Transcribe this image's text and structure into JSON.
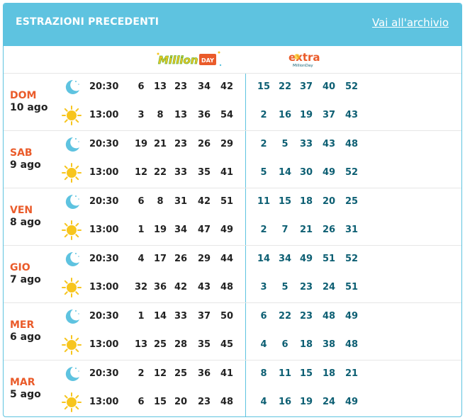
{
  "header": {
    "title": "ESTRAZIONI PRECEDENTI",
    "archive_link": "Vai all'archivio"
  },
  "logos": {
    "million": "Million",
    "million_day": "DAY",
    "extra": "extra",
    "extra_sub": "MillionDay"
  },
  "colors": {
    "header_bg": "#5ec3e0",
    "day_name": "#ea5b2a",
    "extra_numbers": "#0d5f73",
    "moon": "#5ec3e0",
    "sun": "#f7c51e"
  },
  "icons": {
    "evening": "moon-icon",
    "midday": "sun-icon"
  },
  "days": [
    {
      "name": "DOM",
      "date": "10 ago",
      "draws": [
        {
          "time": "20:30",
          "numbers": [
            "6",
            "13",
            "23",
            "34",
            "42"
          ],
          "extra": [
            "15",
            "22",
            "37",
            "40",
            "52"
          ]
        },
        {
          "time": "13:00",
          "numbers": [
            "3",
            "8",
            "13",
            "36",
            "54"
          ],
          "extra": [
            "2",
            "16",
            "19",
            "37",
            "43"
          ]
        }
      ]
    },
    {
      "name": "SAB",
      "date": "9 ago",
      "draws": [
        {
          "time": "20:30",
          "numbers": [
            "19",
            "21",
            "23",
            "26",
            "29"
          ],
          "extra": [
            "2",
            "5",
            "33",
            "43",
            "48"
          ]
        },
        {
          "time": "13:00",
          "numbers": [
            "12",
            "22",
            "33",
            "35",
            "41"
          ],
          "extra": [
            "5",
            "14",
            "30",
            "49",
            "52"
          ]
        }
      ]
    },
    {
      "name": "VEN",
      "date": "8 ago",
      "draws": [
        {
          "time": "20:30",
          "numbers": [
            "6",
            "8",
            "31",
            "42",
            "51"
          ],
          "extra": [
            "11",
            "15",
            "18",
            "20",
            "25"
          ]
        },
        {
          "time": "13:00",
          "numbers": [
            "1",
            "19",
            "34",
            "47",
            "49"
          ],
          "extra": [
            "2",
            "7",
            "21",
            "26",
            "31"
          ]
        }
      ]
    },
    {
      "name": "GIO",
      "date": "7 ago",
      "draws": [
        {
          "time": "20:30",
          "numbers": [
            "4",
            "17",
            "26",
            "29",
            "44"
          ],
          "extra": [
            "14",
            "34",
            "49",
            "51",
            "52"
          ]
        },
        {
          "time": "13:00",
          "numbers": [
            "32",
            "36",
            "42",
            "43",
            "48"
          ],
          "extra": [
            "3",
            "5",
            "23",
            "24",
            "51"
          ]
        }
      ]
    },
    {
      "name": "MER",
      "date": "6 ago",
      "draws": [
        {
          "time": "20:30",
          "numbers": [
            "1",
            "14",
            "33",
            "37",
            "50"
          ],
          "extra": [
            "6",
            "22",
            "23",
            "48",
            "49"
          ]
        },
        {
          "time": "13:00",
          "numbers": [
            "13",
            "25",
            "28",
            "35",
            "45"
          ],
          "extra": [
            "4",
            "6",
            "18",
            "38",
            "48"
          ]
        }
      ]
    },
    {
      "name": "MAR",
      "date": "5 ago",
      "draws": [
        {
          "time": "20:30",
          "numbers": [
            "2",
            "12",
            "25",
            "36",
            "41"
          ],
          "extra": [
            "8",
            "11",
            "15",
            "18",
            "21"
          ]
        },
        {
          "time": "13:00",
          "numbers": [
            "6",
            "15",
            "20",
            "23",
            "48"
          ],
          "extra": [
            "4",
            "16",
            "19",
            "24",
            "49"
          ]
        }
      ]
    }
  ]
}
